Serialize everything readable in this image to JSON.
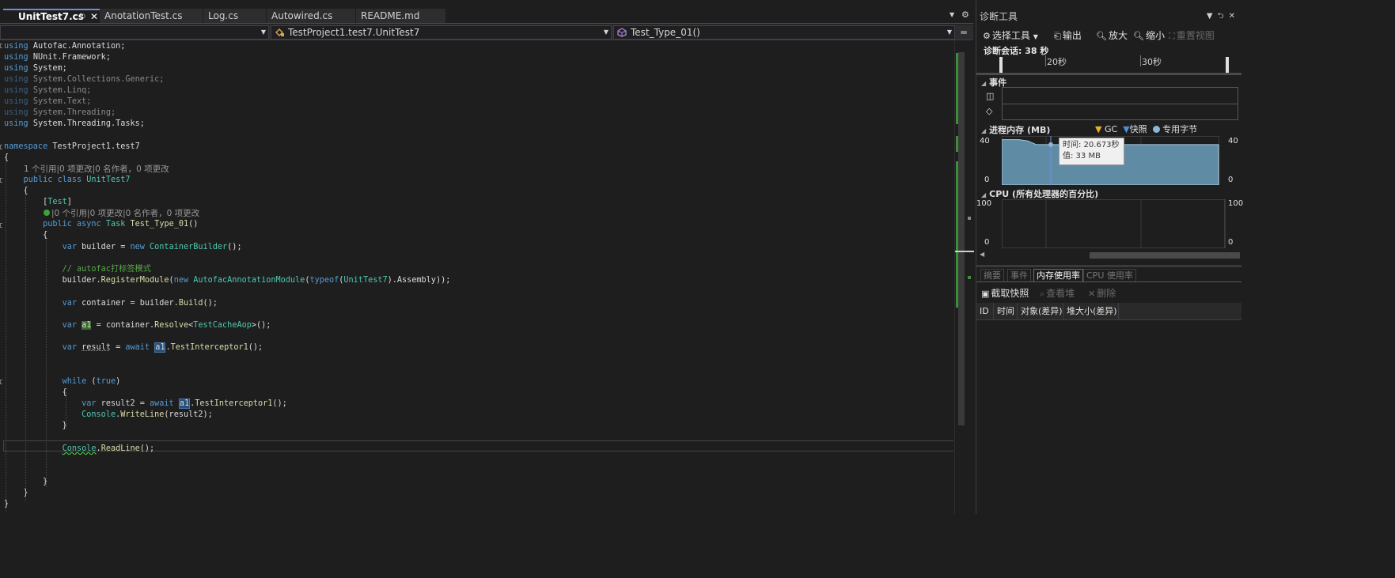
{
  "tabs": [
    {
      "label": "UnitTest7.cs",
      "active": true
    },
    {
      "label": "AnotationTest.cs",
      "active": false
    },
    {
      "label": "Log.cs",
      "active": false
    },
    {
      "label": "Autowired.cs",
      "active": false
    },
    {
      "label": "README.md",
      "active": false
    }
  ],
  "navbar": {
    "project": "",
    "class": "TestProject1.test7.UnitTest7",
    "member": "Test_Type_01()"
  },
  "code": {
    "using1": "Autofac.Annotation;",
    "using2": "NUnit.Framework;",
    "using3": "System;",
    "using4": "System.Collections.Generic;",
    "using5": "System.Linq;",
    "using6": "System.Text;",
    "using7": "System.Threading;",
    "using8": "System.Threading.Tasks;",
    "namespace": "TestProject1.test7",
    "lens_class": "1 个引用|0 项更改|0 名作者，0 项更改",
    "class_name": "UnitTest7",
    "attribute": "Test",
    "lens_method": "|0 个引用|0 项更改|0 名作者，0 项更改",
    "method_name": "Test_Type_01",
    "comment": "// autofac打标签模式"
  },
  "diagnostics": {
    "title": "诊断工具",
    "toolbar": {
      "select_tools": "选择工具",
      "output": "输出",
      "zoom_in": "放大",
      "zoom_out": "缩小",
      "reset_view": "重置视图"
    },
    "session": "诊断会话: 38 秒",
    "timeline_labels": [
      "20秒",
      "30秒"
    ],
    "events_header": "事件",
    "memory_header": "进程内存 (MB)",
    "legend": {
      "gc": "GC",
      "snapshot": "快照",
      "private_bytes": "专用字节"
    },
    "memory_axis": {
      "max": "40",
      "min": "0"
    },
    "memory_values_mb": [
      37,
      37,
      37,
      36,
      33,
      33,
      33,
      33,
      33,
      33,
      33,
      33,
      33,
      33,
      33,
      33,
      33,
      33,
      33,
      33,
      33,
      33,
      33,
      33,
      33,
      33
    ],
    "tooltip": {
      "time": "时间: 20.673秒",
      "value": "值: 33 MB"
    },
    "cpu_header": "CPU (所有处理器的百分比)",
    "cpu_axis": {
      "max": "100",
      "min": "0"
    },
    "tabs": [
      "摘要",
      "事件",
      "内存使用率",
      "CPU 使用率"
    ],
    "active_tab": "内存使用率",
    "subbar": {
      "snapshot": "截取快照",
      "view_heap": "查看堆",
      "delete": "删除"
    },
    "columns": [
      "ID",
      "时间",
      "对象(差异)",
      "堆大小(差异)"
    ],
    "colors": {
      "memory_fill": "#5f8ba5",
      "memory_line": "#a9c9dc",
      "accent": "#6f8dd6"
    }
  }
}
